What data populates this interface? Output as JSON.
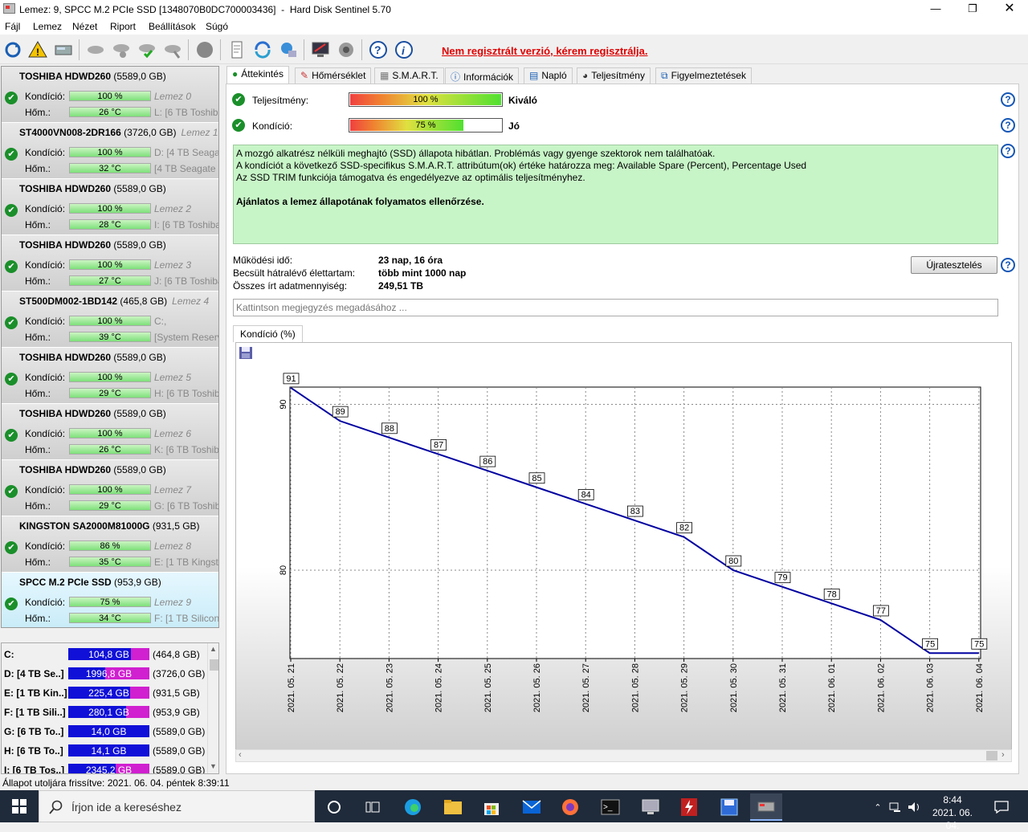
{
  "window": {
    "title": "Lemez: 9, SPCC M.2 PCIe SSD [1348070B0DC700003436]  -  Hard Disk Sentinel 5.70"
  },
  "menu": [
    "Fájl",
    "Lemez",
    "Nézet",
    "Riport",
    "Beállítások",
    "Súgó"
  ],
  "toolbar": {
    "reg_warning": "Nem regisztrált verzió, kérem regisztrálja."
  },
  "disks": [
    {
      "name": "TOSHIBA HDWD260",
      "size": "(5589,0 GB)",
      "tag": "",
      "health_label": "Kondíció:",
      "health": "100 %",
      "health_val": 100,
      "disk_idx": "Lemez 0",
      "temp_label": "Hőm.:",
      "temp": "26 °C",
      "vol": "L: [6 TB Toshiba"
    },
    {
      "name": "ST4000VN008-2DR166",
      "size": "(3726,0 GB)",
      "tag": "Lemez 1",
      "health_label": "Kondíció:",
      "health": "100 %",
      "health_val": 100,
      "disk_idx": "D: [4 TB Seagate",
      "temp_label": "Hőm.:",
      "temp": "32 °C",
      "vol": "[4 TB Seagate li"
    },
    {
      "name": "TOSHIBA HDWD260",
      "size": "(5589,0 GB)",
      "tag": "",
      "health_label": "Kondíció:",
      "health": "100 %",
      "health_val": 100,
      "disk_idx": "Lemez 2",
      "temp_label": "Hőm.:",
      "temp": "28 °C",
      "vol": "I: [6 TB Toshiba"
    },
    {
      "name": "TOSHIBA HDWD260",
      "size": "(5589,0 GB)",
      "tag": "",
      "health_label": "Kondíció:",
      "health": "100 %",
      "health_val": 100,
      "disk_idx": "Lemez 3",
      "temp_label": "Hőm.:",
      "temp": "27 °C",
      "vol": "J: [6 TB Toshiba"
    },
    {
      "name": "ST500DM002-1BD142",
      "size": "(465,8 GB)",
      "tag": "Lemez 4",
      "health_label": "Kondíció:",
      "health": "100 %",
      "health_val": 100,
      "disk_idx": "C:,",
      "temp_label": "Hőm.:",
      "temp": "39 °C",
      "vol": "[System Reserv"
    },
    {
      "name": "TOSHIBA HDWD260",
      "size": "(5589,0 GB)",
      "tag": "",
      "health_label": "Kondíció:",
      "health": "100 %",
      "health_val": 100,
      "disk_idx": "Lemez 5",
      "temp_label": "Hőm.:",
      "temp": "29 °C",
      "vol": "H: [6 TB Toshib"
    },
    {
      "name": "TOSHIBA HDWD260",
      "size": "(5589,0 GB)",
      "tag": "",
      "health_label": "Kondíció:",
      "health": "100 %",
      "health_val": 100,
      "disk_idx": "Lemez 6",
      "temp_label": "Hőm.:",
      "temp": "26 °C",
      "vol": "K: [6 TB Toshib"
    },
    {
      "name": "TOSHIBA HDWD260",
      "size": "(5589,0 GB)",
      "tag": "",
      "health_label": "Kondíció:",
      "health": "100 %",
      "health_val": 100,
      "disk_idx": "Lemez 7",
      "temp_label": "Hőm.:",
      "temp": "29 °C",
      "vol": "G: [6 TB Toshib"
    },
    {
      "name": "KINGSTON SA2000M81000G",
      "size": "(931,5 GB)",
      "tag": "",
      "health_label": "Kondíció:",
      "health": "86 %",
      "health_val": 86,
      "disk_idx": "Lemez 8",
      "temp_label": "Hőm.:",
      "temp": "35 °C",
      "vol": "E: [1 TB Kingsto"
    },
    {
      "name": "SPCC M.2 PCIe SSD",
      "size": "(953,9 GB)",
      "tag": "",
      "health_label": "Kondíció:",
      "health": "75 %",
      "health_val": 75,
      "disk_idx": "Lemez 9",
      "temp_label": "Hőm.:",
      "temp": "34 °C",
      "vol": "F: [1 TB SiliconP"
    }
  ],
  "volumes": [
    {
      "name": "C:",
      "free": "104,8 GB",
      "size": "(464,8 GB)",
      "used_fraction": 0.77
    },
    {
      "name": "D: [4 TB Se..]",
      "free": "1996,8 GB",
      "size": "(3726,0 GB)",
      "used_fraction": 0.46
    },
    {
      "name": "E: [1 TB Kin..]",
      "free": "225,4 GB",
      "size": "(931,5 GB)",
      "used_fraction": 0.76
    },
    {
      "name": "F: [1 TB Sili..]",
      "free": "280,1 GB",
      "size": "(953,9 GB)",
      "used_fraction": 0.71
    },
    {
      "name": "G: [6 TB To..]",
      "free": "14,0 GB",
      "size": "(5589,0 GB)",
      "used_fraction": 1.0
    },
    {
      "name": "H: [6 TB To..]",
      "free": "14,1 GB",
      "size": "(5589,0 GB)",
      "used_fraction": 1.0
    },
    {
      "name": "I: [6 TB Tos..]",
      "free": "2345,2 GB",
      "size": "(5589,0 GB)",
      "used_fraction": 0.58
    }
  ],
  "tabs": [
    "Áttekintés",
    "Hőmérséklet",
    "S.M.A.R.T.",
    "Információk",
    "Napló",
    "Teljesítmény",
    "Figyelmeztetések"
  ],
  "overview": {
    "perf_label": "Teljesítmény:",
    "perf_value": "100 %",
    "perf_pct": 100,
    "perf_text": "Kiváló",
    "health_label": "Kondíció:",
    "health_value": "75 %",
    "health_pct": 75,
    "health_text": "Jó",
    "info_lines": [
      "A mozgó alkatrész nélküli meghajtó (SSD) állapota hibátlan. Problémás vagy gyenge szektorok nem találhatóak.",
      "A kondíciót a következő SSD-specifikus S.M.A.R.T. attribútum(ok) értéke határozza meg:  Available Spare (Percent), Percentage Used",
      "Az SSD TRIM funkciója támogatva és engedélyezve az optimális teljesítményhez."
    ],
    "recommendation": "Ajánlatos a lemez állapotának folyamatos ellenőrzése.",
    "uptime_label": "Működési idő:",
    "uptime": "23 nap, 16 óra",
    "lifetime_label": "Becsült hátralévő élettartam:",
    "lifetime": "több mint 1000 nap",
    "written_label": "Összes írt adatmennyiség:",
    "written": "249,51 TB",
    "retest_label": "Újratesztelés",
    "note_placeholder": "Kattintson megjegyzés megadásához ...",
    "chart_tab": "Kondíció  (%)"
  },
  "chart_data": {
    "type": "line",
    "x": [
      "2021. 05. 21",
      "2021. 05. 22",
      "2021. 05. 23",
      "2021. 05. 24",
      "2021. 05. 25",
      "2021. 05. 26",
      "2021. 05. 27",
      "2021. 05. 28",
      "2021. 05. 29",
      "2021. 05. 30",
      "2021. 05. 31",
      "2021. 06. 01",
      "2021. 06. 02",
      "2021. 06. 03",
      "2021. 06. 04"
    ],
    "series": [
      {
        "values": [
          91,
          89,
          88,
          87,
          86,
          85,
          84,
          83,
          82,
          80,
          79,
          78,
          77,
          75,
          75
        ]
      }
    ],
    "yticks": [
      "90",
      "80"
    ],
    "ylim": [
      75,
      91
    ],
    "grid": true,
    "color": "#0000a0"
  },
  "status": "Állapot utoljára frissítve: 2021. 06. 04. péntek 8:39:11",
  "taskbar": {
    "search_placeholder": "Írjon ide a kereséshez",
    "time": "8:44",
    "date": "2021. 06. 04."
  }
}
